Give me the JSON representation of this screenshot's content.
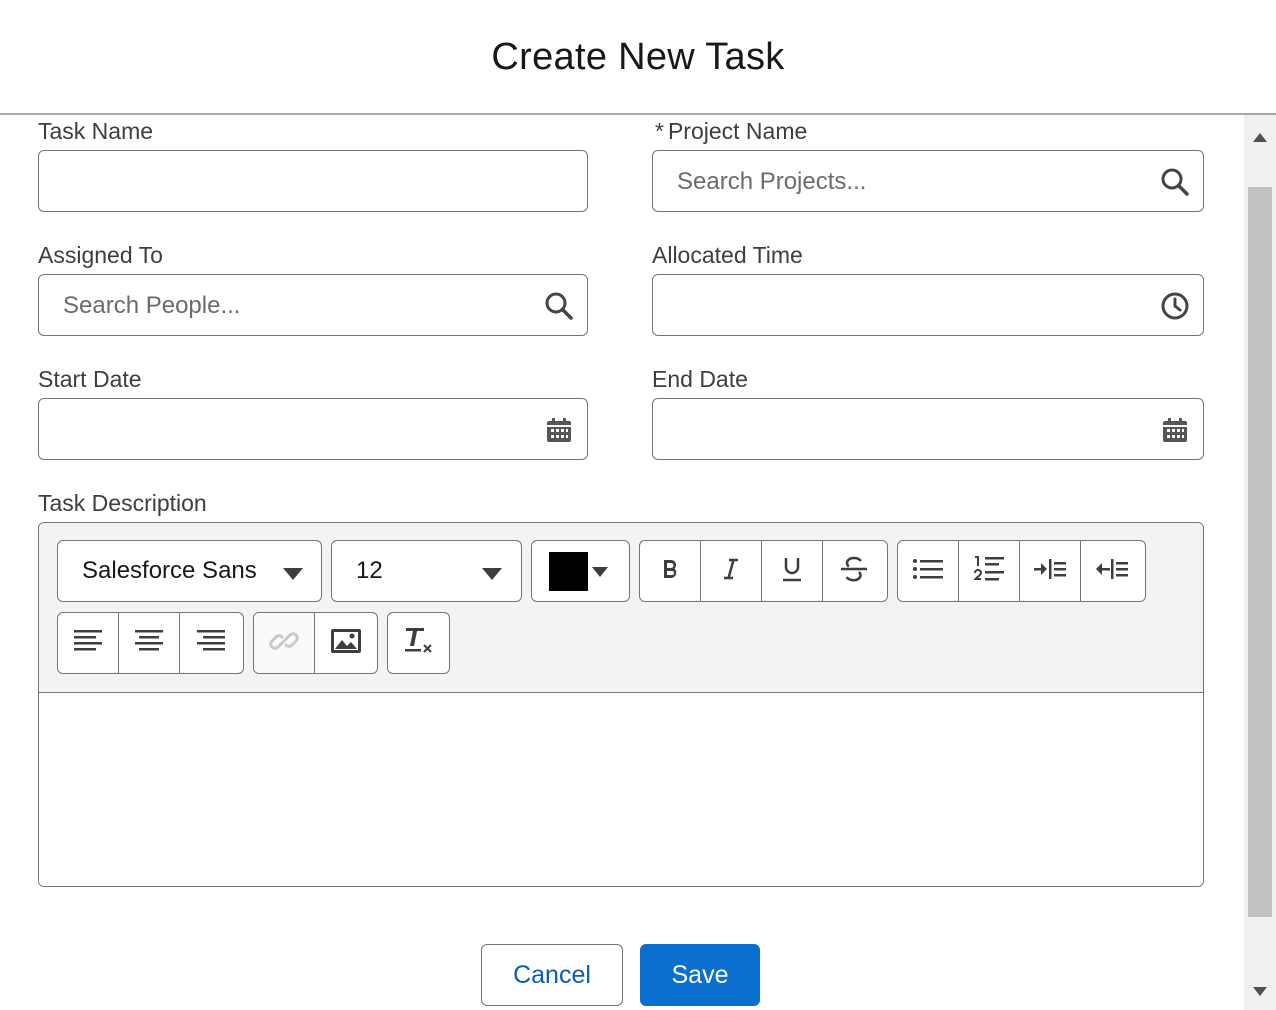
{
  "dialog": {
    "title": "Create New Task"
  },
  "fields": {
    "task_name": {
      "label": "Task Name",
      "value": ""
    },
    "project_name": {
      "required_mark": "*",
      "label": "Project Name",
      "placeholder": "Search Projects..."
    },
    "assigned_to": {
      "label": "Assigned To",
      "placeholder": "Search People..."
    },
    "allocated_time": {
      "label": "Allocated Time",
      "value": ""
    },
    "start_date": {
      "label": "Start Date",
      "value": ""
    },
    "end_date": {
      "label": "End Date",
      "value": ""
    },
    "task_description": {
      "label": "Task Description",
      "value": ""
    }
  },
  "toolbar": {
    "font_family": "Salesforce Sans",
    "font_size": "12",
    "text_color": "#000000",
    "buttons_row1": [
      "bold-icon",
      "italic-icon",
      "underline-icon",
      "strikethrough-icon",
      "bulleted-list-icon",
      "numbered-list-icon",
      "indent-icon",
      "outdent-icon"
    ],
    "buttons_row2": [
      "align-left-icon",
      "align-center-icon",
      "align-right-icon",
      "link-icon",
      "image-icon",
      "remove-formatting-icon"
    ]
  },
  "footer": {
    "cancel_label": "Cancel",
    "save_label": "Save"
  },
  "colors": {
    "brand": "#0b6fd0",
    "border": "#747474",
    "toolbar_bg": "#f3f3f3"
  }
}
